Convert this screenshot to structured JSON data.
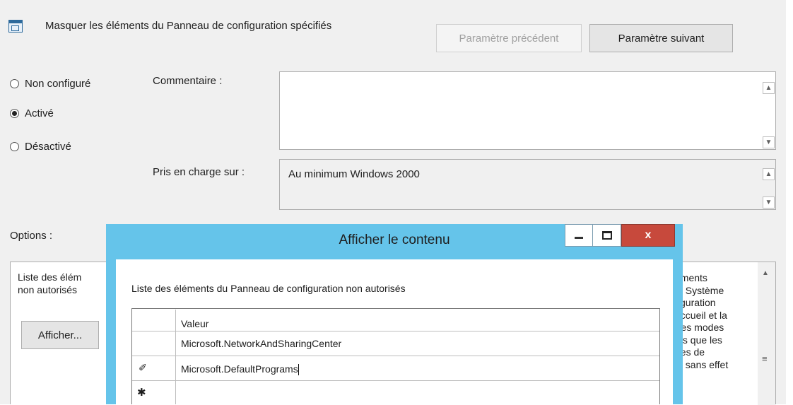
{
  "policy": {
    "title": "Masquer les éléments du Panneau de configuration spécifiés",
    "prev_button": "Paramètre précédent",
    "next_button": "Paramètre suivant"
  },
  "state": {
    "options": [
      "Non configuré",
      "Activé",
      "Désactivé"
    ],
    "selected": "Activé"
  },
  "comment": {
    "label": "Commentaire :",
    "value": ""
  },
  "supported": {
    "label": "Pris en charge sur :",
    "value": "Au minimum Windows 2000"
  },
  "options_label": "Options :",
  "options_panel": {
    "list_label_line1": "Liste des élém",
    "list_label_line2": "non autorisés",
    "show_button": "Afficher..."
  },
  "help_fragments": [
    "éments",
    "s, Système",
    "figuration",
    "accueil et la",
    "tres modes",
    "els que les",
    "nes de",
    "st sans effet"
  ],
  "dialog": {
    "title": "Afficher le contenu",
    "minimize": "–",
    "maximize": "□",
    "close": "x",
    "list_label": "Liste des éléments du Panneau de configuration non autorisés",
    "column_header": "Valeur",
    "rows": [
      {
        "marker": "",
        "value": "Microsoft.NetworkAndSharingCenter"
      },
      {
        "marker": "✐",
        "value": "Microsoft.DefaultPrograms"
      },
      {
        "marker": "✱",
        "value": ""
      }
    ]
  },
  "colors": {
    "dialog_frame": "#65c4ea",
    "close_button": "#c7493c"
  }
}
